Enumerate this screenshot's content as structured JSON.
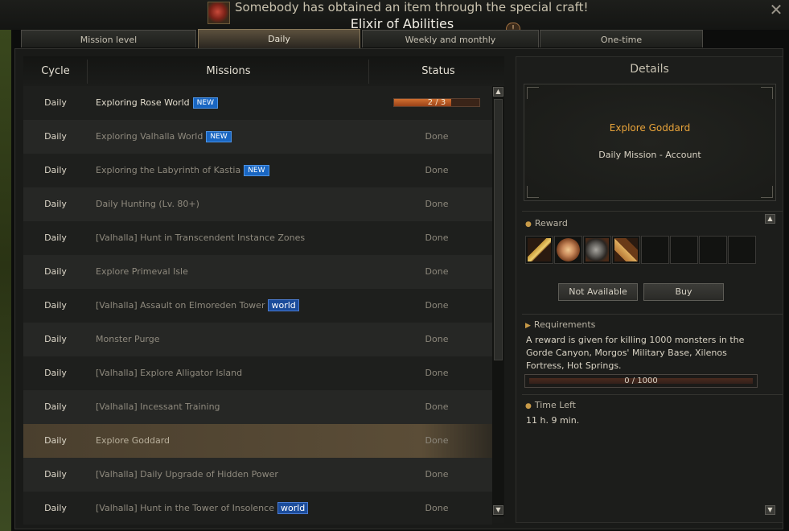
{
  "banner": {
    "message": "Somebody has obtained an item through the special craft!",
    "item_name": "Elixir of Abilities",
    "icon": "elixir-icon"
  },
  "window": {
    "close": "✕",
    "info_badge": "!"
  },
  "tabs": [
    {
      "label": "Mission level"
    },
    {
      "label": "Daily"
    },
    {
      "label": "Weekly and monthly"
    },
    {
      "label": "One-time"
    }
  ],
  "table": {
    "headers": {
      "cycle": "Cycle",
      "missions": "Missions",
      "status": "Status"
    },
    "rows": [
      {
        "cycle": "Daily",
        "mission": "Exploring Rose World",
        "tag": "NEW",
        "status": "2 / 3",
        "progress": 0.667
      },
      {
        "cycle": "Daily",
        "mission": "Exploring Valhalla World",
        "tag": "NEW",
        "status": "Done"
      },
      {
        "cycle": "Daily",
        "mission": "Exploring the Labyrinth of Kastia",
        "tag": "NEW",
        "status": "Done"
      },
      {
        "cycle": "Daily",
        "mission": "Daily Hunting (Lv. 80+)",
        "tag": "",
        "status": "Done"
      },
      {
        "cycle": "Daily",
        "mission": "[Valhalla] Hunt in Transcendent Instance Zones",
        "tag": "",
        "status": "Done"
      },
      {
        "cycle": "Daily",
        "mission": "Explore Primeval Isle",
        "tag": "",
        "status": "Done"
      },
      {
        "cycle": "Daily",
        "mission": "[Valhalla] Assault on Elmoreden Tower",
        "tag": "world",
        "status": "Done"
      },
      {
        "cycle": "Daily",
        "mission": "Monster Purge",
        "tag": "",
        "status": "Done"
      },
      {
        "cycle": "Daily",
        "mission": "[Valhalla] Explore Alligator Island",
        "tag": "",
        "status": "Done"
      },
      {
        "cycle": "Daily",
        "mission": "[Valhalla] Incessant Training",
        "tag": "",
        "status": "Done"
      },
      {
        "cycle": "Daily",
        "mission": "Explore Goddard",
        "tag": "",
        "status": "Done"
      },
      {
        "cycle": "Daily",
        "mission": "[Valhalla] Daily Upgrade of Hidden Power",
        "tag": "",
        "status": "Done"
      },
      {
        "cycle": "Daily",
        "mission": "[Valhalla] Hunt in the Tower of Insolence",
        "tag": "world",
        "status": "Done"
      }
    ]
  },
  "details": {
    "title": "Details",
    "mission_name": "Explore Goddard",
    "mission_type": "Daily Mission  -  Account",
    "reward_label": "Reward",
    "reward_icons": [
      "golden-staff-icon",
      "bronze-coin-icon",
      "ore-chunk-icon",
      "scroll-book-icon"
    ],
    "not_available_label": "Not Available",
    "buy_label": "Buy",
    "requirements_label": "Requirements",
    "requirements_text": "A reward is given for killing 1000 monsters in the Gorde Canyon, Morgos' Military Base, Xilenos Fortress, Hot Springs.",
    "requirement_progress": "0 / 1000",
    "time_left_label": "Time Left",
    "time_left": "11 h. 9 min."
  },
  "colors": {
    "accent": "#e8a33a",
    "new_tag": "#1966c2",
    "world_tag": "#1b4c9b",
    "progress_fill": "#d07030"
  }
}
